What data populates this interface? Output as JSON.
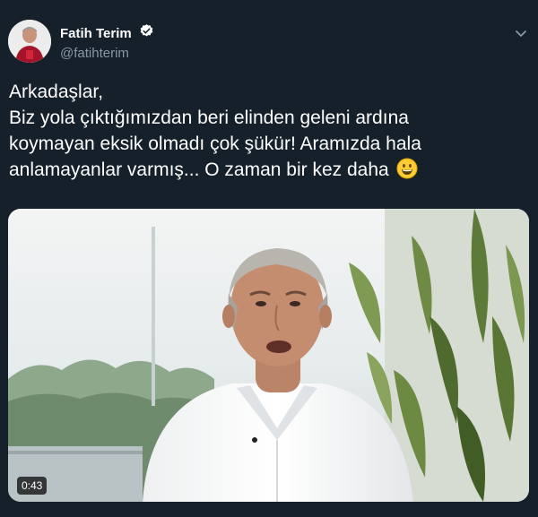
{
  "author": {
    "display_name": "Fatih Terim",
    "handle": "@fatihterim",
    "verified": true
  },
  "icons": {
    "verified": "verified-badge-icon",
    "more": "chevron-down-icon",
    "emoji": "grinning-face-emoji"
  },
  "tweet": {
    "lines": [
      "Arkadaşlar,",
      "Biz yola çıktığımızdan beri elinden geleni ardına",
      "koymayan eksik olmadı çok şükür! Aramızda hala",
      "anlamayanlar varmış... O zaman bir kez daha"
    ]
  },
  "media": {
    "duration": "0:43"
  },
  "colors": {
    "background": "#15202b",
    "verified_badge": "#ffffff",
    "secondary_text": "#8899a6"
  }
}
